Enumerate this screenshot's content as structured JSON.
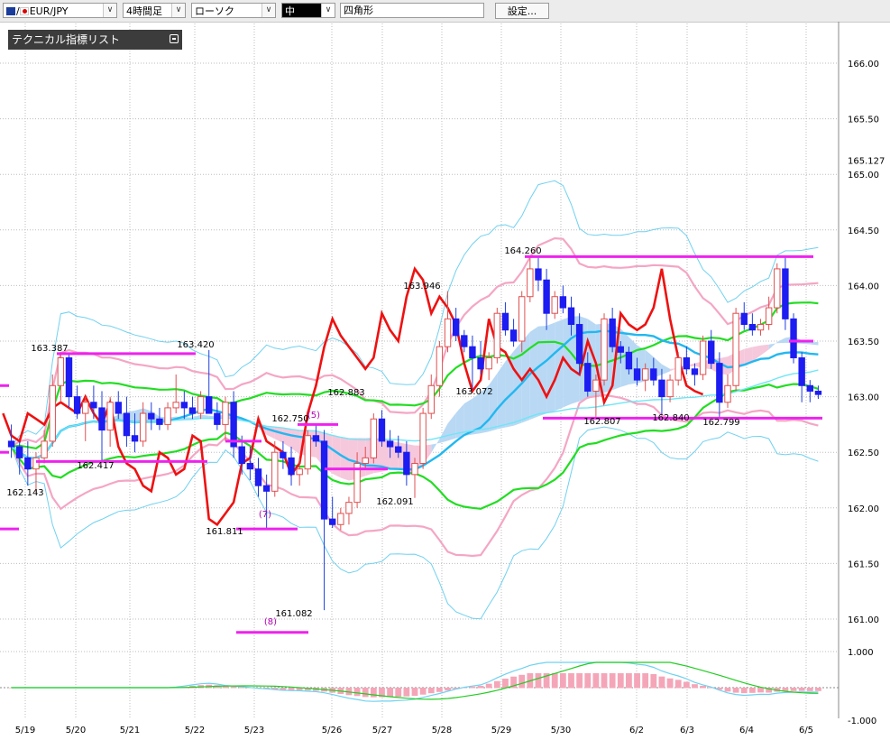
{
  "toolbar": {
    "pair": "EUR/JPY",
    "timeframe": "4時間足",
    "chart_type": "ローソク",
    "line_width": "中",
    "shape": "四角形",
    "settings": "設定..."
  },
  "tech_list": "テクニカル指標リスト",
  "chart_data": {
    "type": "candlestick",
    "yticks": [
      "166.00",
      "165.50",
      "165.127",
      "165.00",
      "164.50",
      "164.00",
      "163.50",
      "163.00",
      "162.50",
      "162.00",
      "161.50",
      "161.00"
    ],
    "osc_ticks": [
      "1.000",
      "-1.000"
    ],
    "xlabels": [
      "5/19",
      "5/20",
      "5/21",
      "5/22",
      "5/23",
      "5/26",
      "5/27",
      "5/28",
      "5/29",
      "5/30",
      "6/2",
      "6/3",
      "6/4",
      "6/5"
    ],
    "ylim": [
      160.5,
      166.4
    ],
    "annotations": [
      "162.143",
      "163.387",
      "162.417",
      "163.420",
      "161.811",
      "162.750",
      "161.082",
      "162.883",
      "162.091",
      "163.946",
      "163.072",
      "164.260",
      "162.807",
      "162.840",
      "162.799"
    ],
    "markers": [
      "(5)",
      "(7)",
      "(8)"
    ],
    "candles": [
      [
        162.6,
        162.75,
        162.45,
        162.55
      ],
      [
        162.55,
        162.6,
        162.3,
        162.45
      ],
      [
        162.45,
        162.6,
        162.2,
        162.35
      ],
      [
        162.35,
        162.5,
        162.14,
        162.45
      ],
      [
        162.45,
        162.7,
        162.4,
        162.6
      ],
      [
        162.6,
        163.2,
        162.55,
        163.1
      ],
      [
        163.1,
        163.4,
        162.95,
        163.35
      ],
      [
        163.35,
        163.38,
        162.9,
        163.0
      ],
      [
        163.0,
        163.1,
        162.8,
        162.85
      ],
      [
        162.85,
        163.0,
        162.6,
        162.95
      ],
      [
        162.95,
        163.1,
        162.8,
        162.9
      ],
      [
        162.9,
        163.05,
        162.42,
        162.7
      ],
      [
        162.7,
        163.0,
        162.55,
        162.95
      ],
      [
        162.95,
        163.05,
        162.8,
        162.85
      ],
      [
        162.85,
        163.0,
        162.55,
        162.65
      ],
      [
        162.65,
        162.85,
        162.5,
        162.6
      ],
      [
        162.6,
        162.95,
        162.55,
        162.85
      ],
      [
        162.85,
        162.95,
        162.7,
        162.8
      ],
      [
        162.8,
        162.9,
        162.7,
        162.75
      ],
      [
        162.75,
        162.95,
        162.7,
        162.9
      ],
      [
        162.9,
        163.2,
        162.85,
        162.95
      ],
      [
        162.95,
        163.05,
        162.8,
        162.9
      ],
      [
        162.9,
        163.0,
        162.8,
        162.85
      ],
      [
        162.85,
        163.05,
        162.8,
        163.0
      ],
      [
        163.0,
        163.42,
        162.9,
        162.85
      ],
      [
        162.85,
        162.95,
        162.7,
        162.75
      ],
      [
        162.75,
        163.0,
        162.6,
        162.95
      ],
      [
        162.95,
        163.05,
        162.45,
        162.55
      ],
      [
        162.55,
        162.65,
        162.3,
        162.4
      ],
      [
        162.4,
        162.55,
        162.25,
        162.35
      ],
      [
        162.35,
        162.45,
        162.1,
        162.2
      ],
      [
        162.2,
        162.3,
        161.81,
        162.15
      ],
      [
        162.15,
        162.6,
        162.1,
        162.5
      ],
      [
        162.5,
        162.6,
        162.35,
        162.45
      ],
      [
        162.45,
        162.55,
        162.2,
        162.3
      ],
      [
        162.3,
        162.45,
        162.2,
        162.35
      ],
      [
        162.35,
        162.7,
        162.3,
        162.65
      ],
      [
        162.65,
        162.75,
        162.55,
        162.6
      ],
      [
        162.6,
        162.7,
        161.08,
        161.9
      ],
      [
        161.9,
        162.1,
        161.82,
        161.85
      ],
      [
        161.85,
        162.0,
        161.8,
        161.95
      ],
      [
        161.95,
        162.1,
        161.85,
        162.05
      ],
      [
        162.05,
        162.5,
        162.0,
        162.4
      ],
      [
        162.4,
        162.55,
        162.35,
        162.45
      ],
      [
        162.45,
        162.85,
        162.4,
        162.8
      ],
      [
        162.8,
        162.88,
        162.55,
        162.6
      ],
      [
        162.6,
        162.7,
        162.45,
        162.55
      ],
      [
        162.55,
        162.65,
        162.45,
        162.5
      ],
      [
        162.5,
        162.6,
        162.2,
        162.3
      ],
      [
        162.3,
        162.45,
        162.09,
        162.4
      ],
      [
        162.4,
        162.9,
        162.35,
        162.85
      ],
      [
        162.85,
        163.2,
        162.8,
        163.1
      ],
      [
        163.1,
        163.5,
        163.0,
        163.45
      ],
      [
        163.45,
        163.95,
        163.4,
        163.7
      ],
      [
        163.7,
        163.8,
        163.5,
        163.55
      ],
      [
        163.55,
        163.6,
        163.4,
        163.45
      ],
      [
        163.45,
        163.55,
        163.07,
        163.35
      ],
      [
        163.35,
        163.5,
        163.2,
        163.25
      ],
      [
        163.25,
        163.4,
        163.15,
        163.35
      ],
      [
        163.35,
        163.8,
        163.3,
        163.75
      ],
      [
        163.75,
        163.85,
        163.55,
        163.6
      ],
      [
        163.6,
        163.7,
        163.45,
        163.5
      ],
      [
        163.5,
        163.95,
        163.4,
        163.9
      ],
      [
        163.9,
        164.26,
        163.85,
        164.15
      ],
      [
        164.15,
        164.25,
        163.95,
        164.05
      ],
      [
        164.05,
        164.15,
        163.6,
        163.75
      ],
      [
        163.75,
        163.95,
        163.7,
        163.9
      ],
      [
        163.9,
        164.0,
        163.75,
        163.8
      ],
      [
        163.8,
        163.9,
        163.55,
        163.65
      ],
      [
        163.65,
        163.75,
        163.2,
        163.3
      ],
      [
        163.3,
        163.4,
        163.0,
        163.05
      ],
      [
        163.05,
        163.2,
        162.81,
        163.15
      ],
      [
        163.15,
        163.75,
        163.1,
        163.7
      ],
      [
        163.7,
        163.8,
        163.4,
        163.45
      ],
      [
        163.45,
        163.5,
        163.3,
        163.4
      ],
      [
        163.4,
        163.45,
        163.2,
        163.25
      ],
      [
        163.25,
        163.35,
        163.1,
        163.15
      ],
      [
        163.15,
        163.3,
        163.05,
        163.25
      ],
      [
        163.25,
        163.35,
        163.1,
        163.15
      ],
      [
        163.15,
        163.25,
        162.84,
        163.0
      ],
      [
        163.0,
        163.2,
        162.95,
        163.15
      ],
      [
        163.15,
        163.4,
        163.1,
        163.35
      ],
      [
        163.35,
        163.45,
        163.2,
        163.25
      ],
      [
        163.25,
        163.3,
        163.1,
        163.2
      ],
      [
        163.2,
        163.55,
        163.15,
        163.5
      ],
      [
        163.5,
        163.6,
        163.25,
        163.3
      ],
      [
        163.3,
        163.4,
        162.8,
        162.95
      ],
      [
        162.95,
        163.2,
        162.9,
        163.1
      ],
      [
        163.1,
        163.8,
        163.05,
        163.75
      ],
      [
        163.75,
        163.85,
        163.6,
        163.65
      ],
      [
        163.65,
        163.75,
        163.55,
        163.6
      ],
      [
        163.6,
        163.7,
        163.55,
        163.65
      ],
      [
        163.65,
        163.9,
        163.6,
        163.8
      ],
      [
        163.8,
        164.2,
        163.75,
        164.15
      ],
      [
        164.15,
        164.25,
        163.6,
        163.7
      ],
      [
        163.7,
        163.75,
        163.3,
        163.35
      ],
      [
        163.35,
        163.4,
        162.95,
        163.1
      ],
      [
        163.1,
        163.15,
        162.95,
        163.05
      ],
      [
        163.05,
        163.1,
        162.98,
        163.02
      ]
    ]
  }
}
